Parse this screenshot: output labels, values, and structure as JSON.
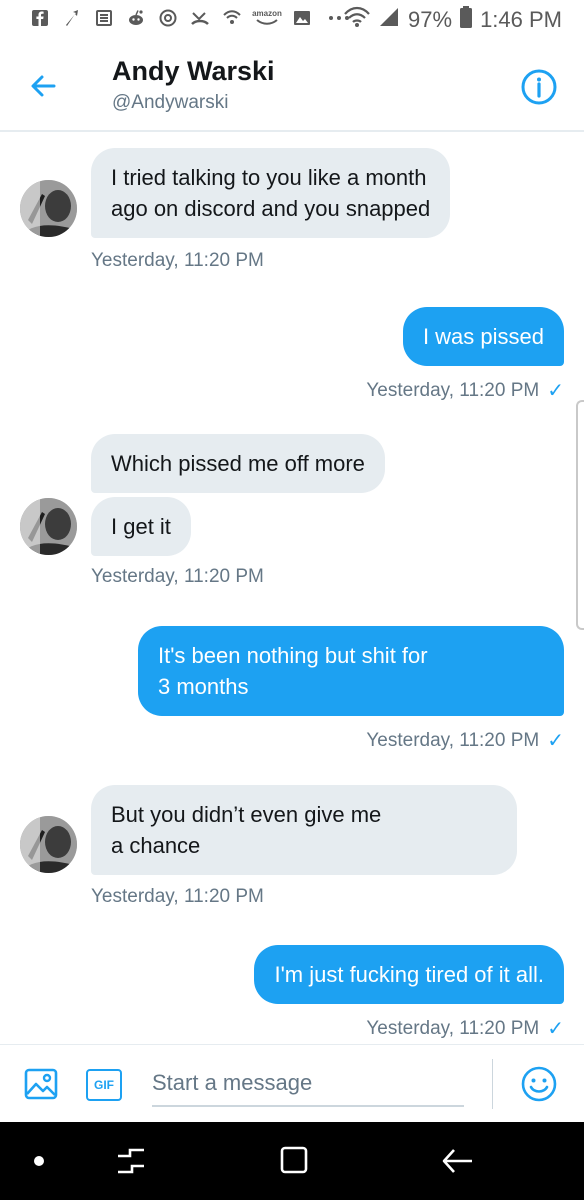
{
  "status_bar": {
    "battery": "97%",
    "time": "1:46 PM",
    "left_icons": [
      "facebook-icon",
      "notification-icon",
      "news-icon",
      "reddit-icon",
      "threads-icon",
      "missed-call-icon",
      "wifi-call-icon",
      "amazon-icon",
      "image-icon",
      "more-icon"
    ],
    "amazon_label": "amazon"
  },
  "header": {
    "name": "Andy Warski",
    "handle": "@Andywarski"
  },
  "messages": [
    {
      "side": "in",
      "text_lines": [
        "I tried talking to you like a month",
        "ago on discord and you snapped"
      ],
      "timestamp": "Yesterday, 11:20 PM"
    },
    {
      "side": "out",
      "text_lines": [
        "I was pissed"
      ],
      "timestamp": "Yesterday, 11:20 PM"
    },
    {
      "side": "in",
      "text_lines": [
        "Which pissed me off more"
      ]
    },
    {
      "side": "in",
      "text_lines": [
        "I get it"
      ],
      "timestamp": "Yesterday, 11:20 PM"
    },
    {
      "side": "out",
      "text_lines": [
        "It's been nothing but shit for",
        "3 months"
      ],
      "timestamp": "Yesterday, 11:20 PM"
    },
    {
      "side": "in",
      "text_lines": [
        "But you didn’t even give me",
        "a chance"
      ],
      "timestamp": "Yesterday, 11:20 PM"
    },
    {
      "side": "out",
      "text_lines": [
        "I'm just fucking tired of it all."
      ],
      "timestamp": "Yesterday, 11:20 PM"
    }
  ],
  "composer": {
    "placeholder": "Start a message",
    "gif_label": "GIF"
  },
  "colors": {
    "accent": "#1da1f2",
    "bubble_in": "#e6ecf0",
    "muted": "#657786"
  }
}
